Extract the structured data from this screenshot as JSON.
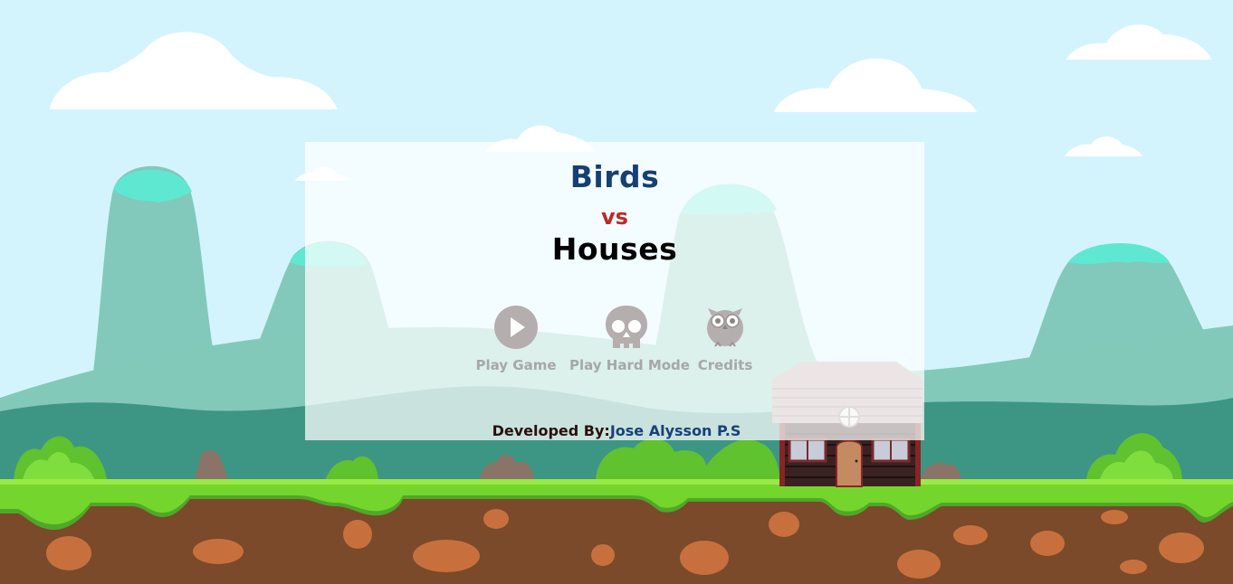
{
  "game": {
    "title_line1": "Birds",
    "title_line2": "vs",
    "title_line3": "Houses"
  },
  "menu": {
    "play_label": "Play Game",
    "hard_label": "Play Hard Mode",
    "credits_label": "Credits"
  },
  "footer": {
    "developed_by_label": "Developed By:",
    "developer_name": "Jose Alysson P.S"
  },
  "colors": {
    "sky": "#d4f4fd",
    "title_blue": "#163f72",
    "vs_red": "#c0282a",
    "menu_gray": "#a7a7a7",
    "grass": "#74d62c",
    "soil": "#7a4a2a"
  },
  "icons": {
    "play": "play-circle-icon",
    "hard": "skull-icon",
    "credits": "owl-icon"
  }
}
